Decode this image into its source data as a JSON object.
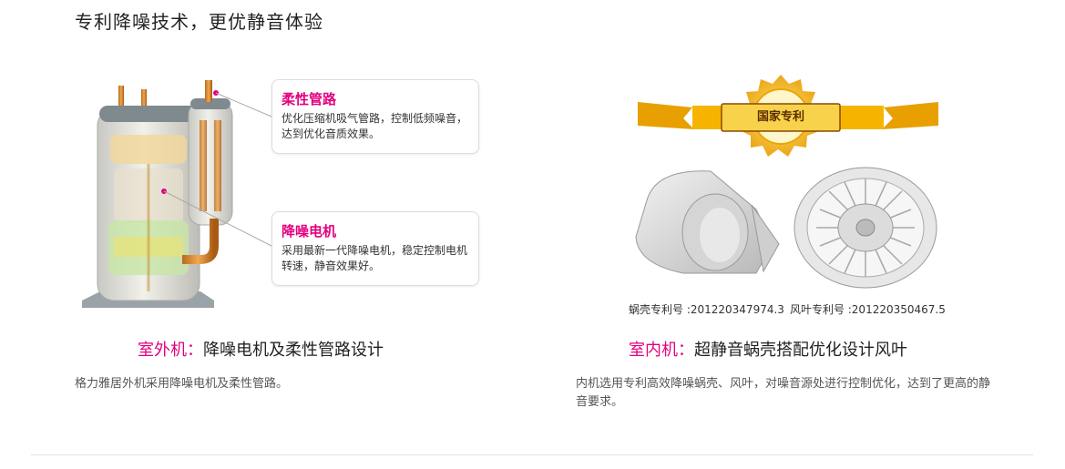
{
  "page_title": "专利降噪技术，更优静音体验",
  "outdoor": {
    "callout_pipe": {
      "title": "柔性管路",
      "text": "优化压缩机吸气管路，控制低频噪音，达到优化音质效果。"
    },
    "callout_motor": {
      "title": "降噪电机",
      "text": "采用最新一代降噪电机，稳定控制电机转速，静音效果好。"
    },
    "heading_accent": "室外机：",
    "heading_text": "降噪电机及柔性管路设计",
    "description": "格力雅居外机采用降噪电机及柔性管路。"
  },
  "indoor": {
    "badge_label": "国家专利",
    "patent_scroll": "蜗壳专利号 :201220347974.3",
    "patent_fan": "风叶专利号 :201220350467.5",
    "heading_accent": "室内机：",
    "heading_text": "超静音蜗壳搭配优化设计风叶",
    "description": "内机选用专利高效降噪蜗壳、风叶，对噪音源处进行控制优化，达到了更高的静音要求。"
  },
  "colors": {
    "accent": "#e4007f",
    "badge_gold": "#f2a900"
  }
}
